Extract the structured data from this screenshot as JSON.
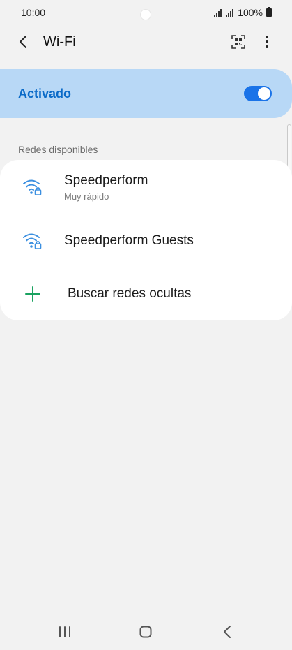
{
  "status_bar": {
    "time": "10:00",
    "battery": "100%",
    "icons": [
      "signal-icon",
      "signal-icon",
      "battery-icon"
    ]
  },
  "app_bar": {
    "title": "Wi-Fi",
    "icons": [
      "back-arrow-icon",
      "qr-code-icon",
      "more-vert-icon"
    ]
  },
  "wifi_toggle": {
    "label": "Activado",
    "state": "on",
    "accent_color": "#1a73e8",
    "card_color": "#b8d8f6",
    "label_color": "#0b6bc8"
  },
  "available_networks": {
    "header": "Redes disponibles",
    "items": [
      {
        "name": "Speedperform",
        "subtitle": "Muy rápido",
        "icon": "wifi-lock-icon"
      },
      {
        "name": "Speedperform Guests",
        "subtitle": "",
        "icon": "wifi-lock-icon"
      }
    ],
    "add_network": {
      "label": "Buscar redes ocultas",
      "icon": "plus-icon",
      "icon_color": "#1aa260"
    }
  },
  "nav_bar": {
    "icons": [
      "recents-icon",
      "home-icon",
      "back-icon"
    ]
  }
}
